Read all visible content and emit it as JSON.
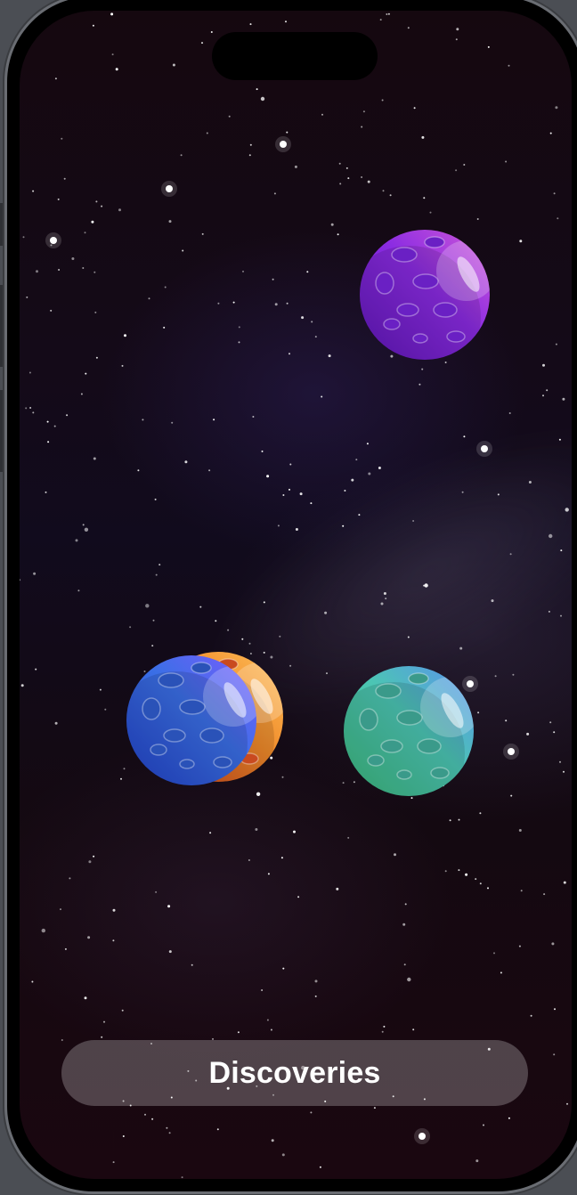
{
  "discover_button": {
    "label": "Discoveries"
  },
  "planets": [
    {
      "name": "purple-planet",
      "base": "#8a2be2",
      "light": "#d25ad8",
      "dark": "#5f16b8",
      "crater": "#6a20c4"
    },
    {
      "name": "orange-planet",
      "base": "#f08a2a",
      "light": "#ffc15a",
      "dark": "#c63a1a",
      "crater": "#c94a1f"
    },
    {
      "name": "blue-planet",
      "base": "#3b6fe6",
      "light": "#7c5cff",
      "dark": "#2141c8",
      "crater": "#2a52b8"
    },
    {
      "name": "green-planet",
      "base": "#4cc5b4",
      "light": "#5b8ff0",
      "dark": "#3bb77b",
      "crater": "#3a9a8a"
    }
  ],
  "colors": {
    "star": "#ffffff",
    "sky": "#140a18"
  }
}
